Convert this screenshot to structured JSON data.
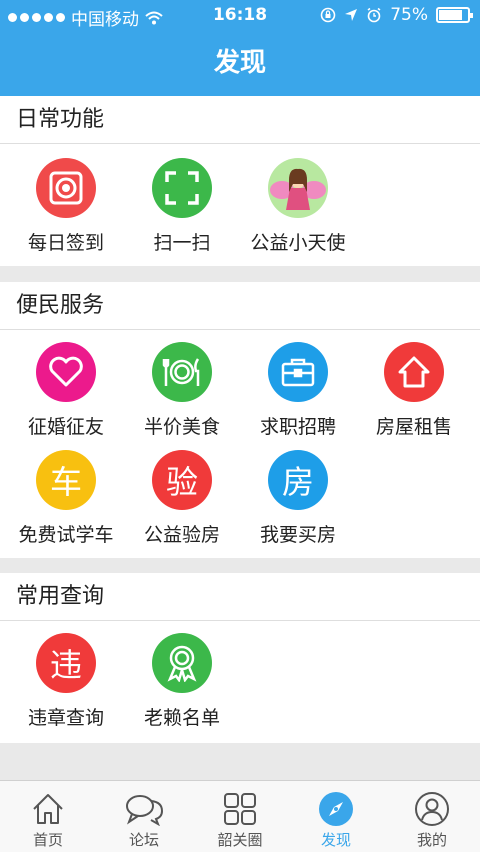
{
  "status_bar": {
    "carrier": "中国移动",
    "time": "16:18",
    "battery": "75%"
  },
  "header": {
    "title": "发现"
  },
  "sections": [
    {
      "title": "日常功能",
      "items": [
        {
          "label": "每日签到",
          "icon": "speaker-icon",
          "color": "#f04a4a"
        },
        {
          "label": "扫一扫",
          "icon": "scan-icon",
          "color": "#3cb84a"
        },
        {
          "label": "公益小天使",
          "icon": "angel-avatar-icon",
          "color": "#b8e8a0"
        }
      ]
    },
    {
      "title": "便民服务",
      "items": [
        {
          "label": "征婚征友",
          "icon": "heart-icon",
          "color": "#ec1a8c"
        },
        {
          "label": "半价美食",
          "icon": "dining-icon",
          "color": "#3cb84a"
        },
        {
          "label": "求职招聘",
          "icon": "briefcase-icon",
          "color": "#1e9ee8"
        },
        {
          "label": "房屋租售",
          "icon": "house-icon",
          "color": "#f03a3a"
        },
        {
          "label": "免费试学车",
          "icon": "car-char-icon",
          "glyph": "车",
          "color": "#f8c010"
        },
        {
          "label": "公益验房",
          "icon": "inspect-char-icon",
          "glyph": "验",
          "color": "#f03a3a"
        },
        {
          "label": "我要买房",
          "icon": "house-char-icon",
          "glyph": "房",
          "color": "#1e9ee8"
        }
      ]
    },
    {
      "title": "常用查询",
      "items": [
        {
          "label": "违章查询",
          "icon": "violation-char-icon",
          "glyph": "违",
          "color": "#f03a3a"
        },
        {
          "label": "老赖名单",
          "icon": "award-badge-icon",
          "color": "#3cb84a"
        }
      ]
    }
  ],
  "tab_bar": [
    {
      "label": "首页",
      "icon": "home-icon",
      "active": false
    },
    {
      "label": "论坛",
      "icon": "chat-bubbles-icon",
      "active": false
    },
    {
      "label": "韶关圈",
      "icon": "grid-icon",
      "active": false
    },
    {
      "label": "发现",
      "icon": "compass-icon",
      "active": true
    },
    {
      "label": "我的",
      "icon": "user-icon",
      "active": false
    }
  ],
  "accent_color": "#3aa6ea"
}
